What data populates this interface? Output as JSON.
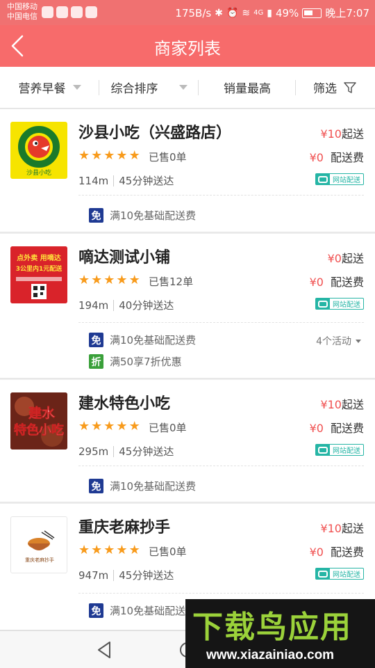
{
  "status_bar": {
    "carrier1": "中国移动",
    "carrier2": "中国电信",
    "net_speed": "175B/s",
    "signal_label": "4G",
    "battery": "49%",
    "time": "晚上7:07"
  },
  "header": {
    "title": "商家列表"
  },
  "filters": [
    {
      "label": "营养早餐"
    },
    {
      "label": "综合排序"
    },
    {
      "label": "销量最高"
    },
    {
      "label": "筛选"
    }
  ],
  "shops": [
    {
      "name": "沙县小吃（兴盛路店）",
      "min_order_price": "¥10",
      "min_order_label": "起送",
      "stars": 5,
      "sold": "已售0单",
      "fee_price": "¥0",
      "fee_label": "配送费",
      "distance": "114m",
      "time": "45分钟送达",
      "delivery_tag": "网站配送",
      "logo_text": "沙县小吃",
      "logo_ring_text": "SHAXIAN DELICACIES",
      "promos": [
        {
          "badge": "免",
          "text": "满10免基础配送费"
        }
      ]
    },
    {
      "name": "嘀达测试小铺",
      "min_order_price": "¥0",
      "min_order_label": "起送",
      "stars": 5,
      "sold": "已售12单",
      "fee_price": "¥0",
      "fee_label": "配送费",
      "distance": "194m",
      "time": "40分钟送达",
      "delivery_tag": "网站配送",
      "logo_text_1": "点外卖 用嘀达",
      "logo_text_2": "3公里内1元配送",
      "activities": "4个活动",
      "promos": [
        {
          "badge": "免",
          "text": "满10免基础配送费"
        },
        {
          "badge": "折",
          "text": "满50享7折优惠"
        }
      ]
    },
    {
      "name": "建水特色小吃",
      "min_order_price": "¥10",
      "min_order_label": "起送",
      "stars": 5,
      "sold": "已售0单",
      "fee_price": "¥0",
      "fee_label": "配送费",
      "distance": "295m",
      "time": "45分钟送达",
      "delivery_tag": "网站配送",
      "logo_text_1": "建水",
      "logo_text_2": "特色小吃",
      "promos": [
        {
          "badge": "免",
          "text": "满10免基础配送费"
        }
      ]
    },
    {
      "name": "重庆老麻抄手",
      "min_order_price": "¥10",
      "min_order_label": "起送",
      "stars": 5,
      "sold": "已售0单",
      "fee_price": "¥0",
      "fee_label": "配送费",
      "distance": "947m",
      "time": "45分钟送达",
      "delivery_tag": "网站配送",
      "logo_text": "重庆老麻抄手",
      "promos": [
        {
          "badge": "免",
          "text": "满10免基础配送费"
        }
      ]
    }
  ],
  "watermark": {
    "main": "下载鸟应用",
    "url": "www.xiazainiao.com"
  },
  "colors": {
    "header": "#f76b6b",
    "price": "#f05050",
    "star": "#f89b1c",
    "delivery": "#25b5a5"
  }
}
